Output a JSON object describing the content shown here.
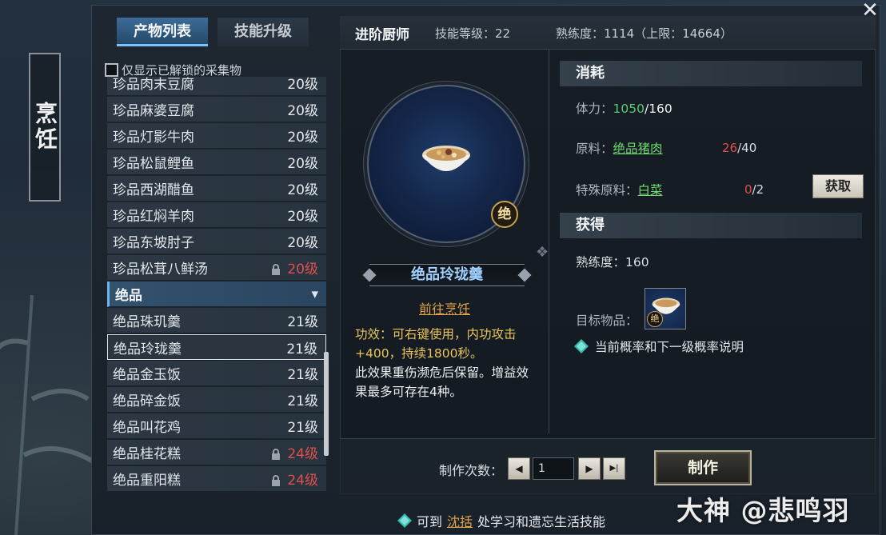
{
  "window": {
    "side_title": "烹饪",
    "close_glyph": "✕"
  },
  "tabs": [
    {
      "label": "产物列表",
      "active": true
    },
    {
      "label": "技能升级",
      "active": false
    }
  ],
  "filter": {
    "label": "仅显示已解锁的采集物",
    "checked": false
  },
  "recipe_list": [
    {
      "name": "珍品肉末豆腐",
      "level": "20级",
      "locked": false
    },
    {
      "name": "珍品麻婆豆腐",
      "level": "20级",
      "locked": false
    },
    {
      "name": "珍品灯影牛肉",
      "level": "20级",
      "locked": false
    },
    {
      "name": "珍品松鼠鲤鱼",
      "level": "20级",
      "locked": false
    },
    {
      "name": "珍品西湖醋鱼",
      "level": "20级",
      "locked": false
    },
    {
      "name": "珍品红焖羊肉",
      "level": "20级",
      "locked": false
    },
    {
      "name": "珍品东坡肘子",
      "level": "20级",
      "locked": false
    },
    {
      "name": "珍品松茸八鲜汤",
      "level": "20级",
      "locked": true
    },
    {
      "name": "绝品",
      "level": "",
      "header": true
    },
    {
      "name": "绝品珠玑羹",
      "level": "21级",
      "locked": false
    },
    {
      "name": "绝品玲珑羹",
      "level": "21级",
      "locked": false,
      "selected": true
    },
    {
      "name": "绝品金玉饭",
      "level": "21级",
      "locked": false
    },
    {
      "name": "绝品碎金饭",
      "level": "21级",
      "locked": false
    },
    {
      "name": "绝品叫花鸡",
      "level": "21级",
      "locked": false
    },
    {
      "name": "绝品桂花糕",
      "level": "24级",
      "locked": true
    },
    {
      "name": "绝品重阳糕",
      "level": "24级",
      "locked": true
    }
  ],
  "info_bar": {
    "title": "进阶厨师",
    "skill_level": "技能等级：22",
    "proficiency": "熟练度：1114（上限：14664）"
  },
  "item": {
    "grade_badge": "绝",
    "name": "绝品玲珑羹",
    "goto_link": "前往烹饪",
    "effect_line1": "功效：可右键使用，内功攻击+400，持续1800秒。",
    "effect_line2": "此效果重伤濒危后保留。增益效果最多可存在4种。"
  },
  "consume": {
    "heading": "消耗",
    "stamina_label": "体力：",
    "stamina_value": "1050",
    "stamina_max": "/160",
    "material_label": "原料：",
    "material_name": "绝品猪肉",
    "material_have": "26",
    "material_need": "/40",
    "special_label": "特殊原料：",
    "special_name": "白菜",
    "special_have": "0",
    "special_need": "/2",
    "get_button": "获取"
  },
  "gain": {
    "heading": "获得",
    "proficiency": "熟练度：160",
    "target_label": "目标物品：",
    "target_badge": "绝",
    "help_text": "当前概率和下一级概率说明"
  },
  "craft": {
    "count_label": "制作次数：",
    "quantity": "1",
    "prev_glyph": "◀",
    "next_glyph": "▶",
    "max_glyph": "▶|",
    "craft_button": "制作"
  },
  "footer": {
    "prefix": "可到",
    "link": "沈括",
    "suffix": "处学习和遗忘生活技能"
  },
  "watermark": "大神 @悲鸣羽",
  "colors": {
    "accent_blue": "#7cc0ff",
    "level_red": "#e0504a",
    "effect_yellow": "#e8c45a",
    "link_orange": "#e1a24a",
    "link_green": "#6fdc6f"
  }
}
